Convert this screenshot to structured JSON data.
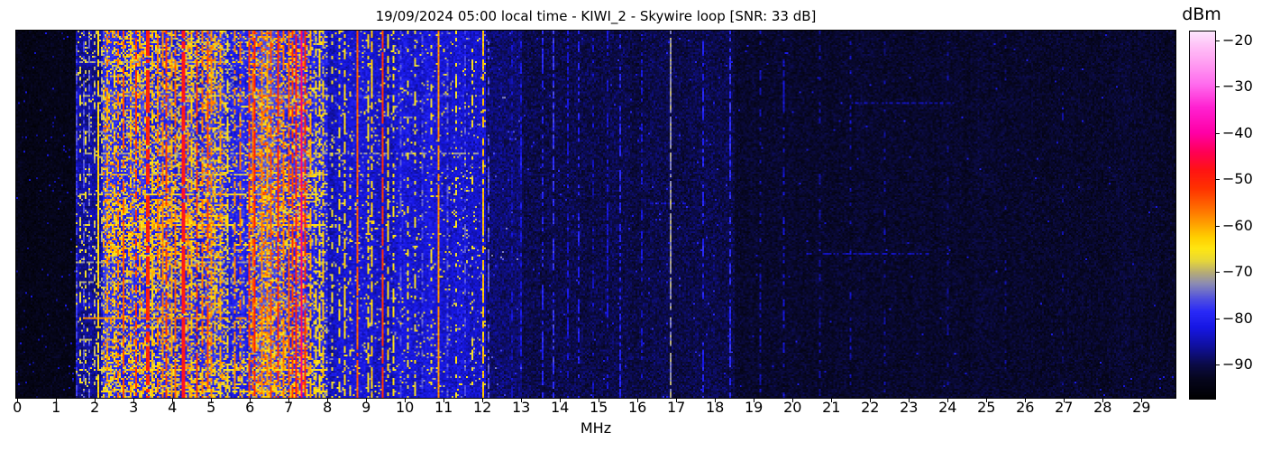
{
  "chart_data": {
    "type": "heatmap",
    "subtype": "spectrogram-waterfall",
    "title": "19/09/2024 05:00 local time - KIWI_2 - Skywire loop [SNR: 33 dB]",
    "xlabel": "MHz",
    "colorbar_label": "dBm",
    "x_range_mhz": [
      -0.05,
      29.9
    ],
    "x_ticks": [
      0,
      1,
      2,
      3,
      4,
      5,
      6,
      7,
      8,
      9,
      10,
      11,
      12,
      13,
      14,
      15,
      16,
      17,
      18,
      19,
      20,
      21,
      22,
      23,
      24,
      25,
      26,
      27,
      28,
      29
    ],
    "value_range_dbm": [
      -97.3,
      -18.1
    ],
    "colorbar_ticks": [
      {
        "value": -20,
        "label": "−20"
      },
      {
        "value": -30,
        "label": "−30"
      },
      {
        "value": -40,
        "label": "−40"
      },
      {
        "value": -50,
        "label": "−50"
      },
      {
        "value": -60,
        "label": "−60"
      },
      {
        "value": -70,
        "label": "−70"
      },
      {
        "value": -80,
        "label": "−80"
      },
      {
        "value": -90,
        "label": "−90"
      }
    ],
    "colormap_stops": [
      {
        "dbm": -97.5,
        "color": "#000000"
      },
      {
        "dbm": -93.0,
        "color": "#06061e"
      },
      {
        "dbm": -90.0,
        "color": "#0b0b46"
      },
      {
        "dbm": -86.0,
        "color": "#10109e"
      },
      {
        "dbm": -82.0,
        "color": "#1717e4"
      },
      {
        "dbm": -78.5,
        "color": "#2a2af8"
      },
      {
        "dbm": -75.5,
        "color": "#5555dd"
      },
      {
        "dbm": -72.5,
        "color": "#8c8cb4"
      },
      {
        "dbm": -70.0,
        "color": "#b8ae74"
      },
      {
        "dbm": -67.5,
        "color": "#e8d838"
      },
      {
        "dbm": -65.0,
        "color": "#ffe713"
      },
      {
        "dbm": -62.5,
        "color": "#ffcf00"
      },
      {
        "dbm": -59.5,
        "color": "#ffa000"
      },
      {
        "dbm": -56.0,
        "color": "#ff6a00"
      },
      {
        "dbm": -52.0,
        "color": "#ff3300"
      },
      {
        "dbm": -48.0,
        "color": "#ff1414"
      },
      {
        "dbm": -44.0,
        "color": "#ff0058"
      },
      {
        "dbm": -40.0,
        "color": "#ff00a6"
      },
      {
        "dbm": -34.5,
        "color": "#ff22d2"
      },
      {
        "dbm": -29.5,
        "color": "#ff6cee"
      },
      {
        "dbm": -25.0,
        "color": "#ff9df2"
      },
      {
        "dbm": -21.0,
        "color": "#ffc4f8"
      },
      {
        "dbm": -18.0,
        "color": "#fde7fe"
      }
    ],
    "noise_regions": [
      {
        "f0": 0.0,
        "f1": 1.5,
        "base": -94,
        "var": 2.5,
        "hot_p": 0.012,
        "hot_min": -88,
        "hot_max": -82
      },
      {
        "f0": 1.5,
        "f1": 2.2,
        "base": -86,
        "var": 3.0,
        "hot_p": 0.06,
        "hot_min": -72,
        "hot_max": -64
      },
      {
        "f0": 2.2,
        "f1": 5.45,
        "base": -80,
        "var": 4.0,
        "hot_p": 0.34,
        "hot_min": -73,
        "hot_max": -58
      },
      {
        "f0": 5.45,
        "f1": 5.95,
        "base": -81,
        "var": 3.5,
        "hot_p": 0.18,
        "hot_min": -73,
        "hot_max": -62
      },
      {
        "f0": 5.95,
        "f1": 7.55,
        "base": -78,
        "var": 4.0,
        "hot_p": 0.4,
        "hot_min": -72,
        "hot_max": -55
      },
      {
        "f0": 7.55,
        "f1": 8.0,
        "base": -80,
        "var": 4.0,
        "hot_p": 0.25,
        "hot_min": -72,
        "hot_max": -62
      },
      {
        "f0": 8.0,
        "f1": 12.1,
        "base": -83,
        "var": 4.0,
        "hot_p": 0.06,
        "hot_min": -75,
        "hot_max": -63
      },
      {
        "f0": 12.1,
        "f1": 13.0,
        "base": -88,
        "var": 3.5,
        "hot_p": 0.01,
        "hot_min": -80,
        "hot_max": -72
      },
      {
        "f0": 13.0,
        "f1": 18.5,
        "base": -90,
        "var": 3.5,
        "hot_p": 0.005,
        "hot_min": -82,
        "hot_max": -78
      },
      {
        "f0": 18.5,
        "f1": 29.95,
        "base": -92,
        "var": 3.0,
        "hot_p": 0.002,
        "hot_min": -84,
        "hot_max": -80
      }
    ],
    "signal_lines": [
      {
        "mhz": 1.53,
        "dbm": -77,
        "density": 0.55,
        "w": 1
      },
      {
        "mhz": 1.62,
        "dbm": -67,
        "density": 0.3,
        "w": 1
      },
      {
        "mhz": 1.7,
        "dbm": -76,
        "density": 0.5,
        "w": 1
      },
      {
        "mhz": 1.76,
        "dbm": -67,
        "density": 0.32,
        "w": 1
      },
      {
        "mhz": 1.85,
        "dbm": -75,
        "density": 0.5,
        "w": 1
      },
      {
        "mhz": 1.95,
        "dbm": -70,
        "density": 0.3,
        "w": 1
      },
      {
        "mhz": 2.05,
        "dbm": -63,
        "density": 0.9,
        "w": 1
      },
      {
        "mhz": 2.17,
        "dbm": -70,
        "density": 0.4,
        "w": 1
      },
      {
        "mhz": 2.3,
        "dbm": -60,
        "density": 0.5,
        "w": 1
      },
      {
        "mhz": 2.47,
        "dbm": -64,
        "density": 0.55,
        "w": 1
      },
      {
        "mhz": 2.6,
        "dbm": -57,
        "density": 0.6,
        "w": 1
      },
      {
        "mhz": 2.72,
        "dbm": -54,
        "density": 0.75,
        "w": 1
      },
      {
        "mhz": 2.88,
        "dbm": -62,
        "density": 0.6,
        "w": 1
      },
      {
        "mhz": 3.02,
        "dbm": -52,
        "density": 0.65,
        "w": 1
      },
      {
        "mhz": 3.15,
        "dbm": -60,
        "density": 0.6,
        "w": 1
      },
      {
        "mhz": 3.33,
        "dbm": -50,
        "density": 0.85,
        "w": 2
      },
      {
        "mhz": 3.48,
        "dbm": -62,
        "density": 0.7,
        "w": 1
      },
      {
        "mhz": 3.6,
        "dbm": -56,
        "density": 0.6,
        "w": 1
      },
      {
        "mhz": 3.72,
        "dbm": -57,
        "density": 0.65,
        "w": 1
      },
      {
        "mhz": 3.85,
        "dbm": -52,
        "density": 0.75,
        "w": 1
      },
      {
        "mhz": 3.95,
        "dbm": -60,
        "density": 0.7,
        "w": 1
      },
      {
        "mhz": 4.05,
        "dbm": -55,
        "density": 0.7,
        "w": 1
      },
      {
        "mhz": 4.27,
        "dbm": -48,
        "density": 0.93,
        "w": 2
      },
      {
        "mhz": 4.4,
        "dbm": -58,
        "density": 0.6,
        "w": 1
      },
      {
        "mhz": 4.5,
        "dbm": -62,
        "density": 0.6,
        "w": 1
      },
      {
        "mhz": 4.62,
        "dbm": -52,
        "density": 0.8,
        "w": 1
      },
      {
        "mhz": 4.75,
        "dbm": -56,
        "density": 0.6,
        "w": 1
      },
      {
        "mhz": 4.9,
        "dbm": -53,
        "density": 0.7,
        "w": 1
      },
      {
        "mhz": 5.0,
        "dbm": -58,
        "density": 0.6,
        "w": 1
      },
      {
        "mhz": 5.1,
        "dbm": -63,
        "density": 0.5,
        "w": 1
      },
      {
        "mhz": 5.25,
        "dbm": -60,
        "density": 0.5,
        "w": 1
      },
      {
        "mhz": 5.4,
        "dbm": -65,
        "density": 0.5,
        "w": 1
      },
      {
        "mhz": 5.6,
        "dbm": -58,
        "density": 0.55,
        "w": 1
      },
      {
        "mhz": 5.75,
        "dbm": -56,
        "density": 0.6,
        "w": 1
      },
      {
        "mhz": 5.95,
        "dbm": -52,
        "density": 0.72,
        "w": 1
      },
      {
        "mhz": 6.05,
        "dbm": -56,
        "density": 0.75,
        "w": 1
      },
      {
        "mhz": 6.12,
        "dbm": -50,
        "density": 0.8,
        "w": 1
      },
      {
        "mhz": 6.3,
        "dbm": -58,
        "density": 0.7,
        "w": 1
      },
      {
        "mhz": 6.45,
        "dbm": -60,
        "density": 0.7,
        "w": 1
      },
      {
        "mhz": 6.55,
        "dbm": -54,
        "density": 0.7,
        "w": 1
      },
      {
        "mhz": 6.7,
        "dbm": -50,
        "density": 0.78,
        "w": 1
      },
      {
        "mhz": 6.85,
        "dbm": -57,
        "density": 0.7,
        "w": 1
      },
      {
        "mhz": 6.98,
        "dbm": -54,
        "density": 0.8,
        "w": 1
      },
      {
        "mhz": 7.08,
        "dbm": -52,
        "density": 0.7,
        "w": 1
      },
      {
        "mhz": 7.18,
        "dbm": -48,
        "density": 0.85,
        "w": 1
      },
      {
        "mhz": 7.32,
        "dbm": -43,
        "density": 0.97,
        "w": 1
      },
      {
        "mhz": 7.42,
        "dbm": -50,
        "density": 0.8,
        "w": 1
      },
      {
        "mhz": 7.55,
        "dbm": -60,
        "density": 0.7,
        "w": 1
      },
      {
        "mhz": 7.68,
        "dbm": -64,
        "density": 0.5,
        "w": 1
      },
      {
        "mhz": 7.8,
        "dbm": -63,
        "density": 0.5,
        "w": 1
      },
      {
        "mhz": 7.9,
        "dbm": -62,
        "density": 0.55,
        "w": 1
      },
      {
        "mhz": 8.1,
        "dbm": -66,
        "density": 0.35,
        "w": 1
      },
      {
        "mhz": 8.3,
        "dbm": -65,
        "density": 0.4,
        "w": 1
      },
      {
        "mhz": 8.45,
        "dbm": -64,
        "density": 0.5,
        "w": 1
      },
      {
        "mhz": 8.6,
        "dbm": -67,
        "density": 0.3,
        "w": 1
      },
      {
        "mhz": 8.75,
        "dbm": -55,
        "density": 0.88,
        "w": 1
      },
      {
        "mhz": 9.05,
        "dbm": -64,
        "density": 0.6,
        "w": 1
      },
      {
        "mhz": 9.15,
        "dbm": -63,
        "density": 0.7,
        "w": 1
      },
      {
        "mhz": 9.4,
        "dbm": -52,
        "density": 0.88,
        "w": 1
      },
      {
        "mhz": 9.55,
        "dbm": -64,
        "density": 0.5,
        "w": 1
      },
      {
        "mhz": 9.7,
        "dbm": -65,
        "density": 0.45,
        "w": 1
      },
      {
        "mhz": 9.9,
        "dbm": -76,
        "density": 0.5,
        "w": 1
      },
      {
        "mhz": 10.05,
        "dbm": -66,
        "density": 0.3,
        "w": 1
      },
      {
        "mhz": 10.25,
        "dbm": -66,
        "density": 0.35,
        "w": 1
      },
      {
        "mhz": 10.45,
        "dbm": -76,
        "density": 0.5,
        "w": 1
      },
      {
        "mhz": 10.65,
        "dbm": -66,
        "density": 0.3,
        "w": 1
      },
      {
        "mhz": 10.85,
        "dbm": -58,
        "density": 0.95,
        "w": 1
      },
      {
        "mhz": 11.1,
        "dbm": -76,
        "density": 0.5,
        "w": 1
      },
      {
        "mhz": 11.3,
        "dbm": -66,
        "density": 0.3,
        "w": 1
      },
      {
        "mhz": 11.55,
        "dbm": -76,
        "density": 0.45,
        "w": 1
      },
      {
        "mhz": 11.75,
        "dbm": -66,
        "density": 0.25,
        "w": 1
      },
      {
        "mhz": 12.0,
        "dbm": -62,
        "density": 0.8,
        "w": 1
      },
      {
        "mhz": 12.15,
        "dbm": -76,
        "density": 0.5,
        "w": 1
      },
      {
        "mhz": 12.75,
        "dbm": -84,
        "density": 0.5,
        "w": 1
      },
      {
        "mhz": 13.0,
        "dbm": -82,
        "density": 0.5,
        "w": 1
      },
      {
        "mhz": 13.55,
        "dbm": -80,
        "density": 0.55,
        "w": 1
      },
      {
        "mhz": 13.85,
        "dbm": -78,
        "density": 0.6,
        "w": 1
      },
      {
        "mhz": 14.2,
        "dbm": -83,
        "density": 0.5,
        "w": 1
      },
      {
        "mhz": 14.5,
        "dbm": -80,
        "density": 0.5,
        "w": 1
      },
      {
        "mhz": 14.85,
        "dbm": -84,
        "density": 0.4,
        "w": 1
      },
      {
        "mhz": 15.25,
        "dbm": -83,
        "density": 0.4,
        "w": 1
      },
      {
        "mhz": 15.55,
        "dbm": -80,
        "density": 0.5,
        "w": 1
      },
      {
        "mhz": 16.1,
        "dbm": -83,
        "density": 0.4,
        "w": 1
      },
      {
        "mhz": 16.85,
        "dbm": -72,
        "density": 0.85,
        "w": 1
      },
      {
        "mhz": 17.7,
        "dbm": -80,
        "density": 0.5,
        "w": 1
      },
      {
        "mhz": 18.4,
        "dbm": -79,
        "density": 0.55,
        "w": 1
      },
      {
        "mhz": 19.2,
        "dbm": -85,
        "density": 0.35,
        "w": 1
      },
      {
        "mhz": 19.8,
        "dbm": -83,
        "density": 0.35,
        "w": 1
      },
      {
        "mhz": 20.7,
        "dbm": -86,
        "density": 0.3,
        "w": 1
      },
      {
        "mhz": 21.5,
        "dbm": -85,
        "density": 0.3,
        "w": 1
      },
      {
        "mhz": 22.4,
        "dbm": -86,
        "density": 0.25,
        "w": 1
      },
      {
        "mhz": 24.0,
        "dbm": -87,
        "density": 0.2,
        "w": 1
      },
      {
        "mhz": 25.5,
        "dbm": -87,
        "density": 0.2,
        "w": 1
      },
      {
        "mhz": 27.0,
        "dbm": -87,
        "density": 0.2,
        "w": 1
      }
    ],
    "bursts": [
      {
        "y": 0.085,
        "f0": 1.6,
        "f1": 5.4,
        "dbm": -71,
        "density": 0.6
      },
      {
        "y": 0.175,
        "f0": 1.6,
        "f1": 8.1,
        "dbm": -69,
        "density": 0.65
      },
      {
        "y": 0.175,
        "f0": 8.1,
        "f1": 12.0,
        "dbm": -77,
        "density": 0.5
      },
      {
        "y": 0.195,
        "f0": 21.5,
        "f1": 24.2,
        "dbm": -85,
        "density": 0.55
      },
      {
        "y": 0.235,
        "f0": 9.95,
        "f1": 10.18,
        "dbm": -73,
        "density": 0.9
      },
      {
        "y": 0.275,
        "f0": 1.6,
        "f1": 5.5,
        "dbm": -73,
        "density": 0.55
      },
      {
        "y": 0.335,
        "f0": 1.6,
        "f1": 12.0,
        "dbm": -72,
        "density": 0.5
      },
      {
        "y": 0.39,
        "f0": 1.6,
        "f1": 8.0,
        "dbm": -70,
        "density": 0.6
      },
      {
        "y": 0.445,
        "f0": 1.6,
        "f1": 8.05,
        "dbm": -68,
        "density": 0.6
      },
      {
        "y": 0.47,
        "f0": 16.3,
        "f1": 17.3,
        "dbm": -84,
        "density": 0.55
      },
      {
        "y": 0.53,
        "f0": 1.6,
        "f1": 8.0,
        "dbm": -66,
        "density": 0.6
      },
      {
        "y": 0.61,
        "f0": 20.3,
        "f1": 23.6,
        "dbm": -85,
        "density": 0.55
      },
      {
        "y": 0.63,
        "f0": 1.5,
        "f1": 8.0,
        "dbm": -72,
        "density": 0.6
      },
      {
        "y": 0.685,
        "f0": 1.6,
        "f1": 6.2,
        "dbm": -71,
        "density": 0.55
      },
      {
        "y": 0.785,
        "f0": 1.6,
        "f1": 6.6,
        "dbm": -59,
        "density": 0.78
      },
      {
        "y": 0.807,
        "f0": 2.0,
        "f1": 8.0,
        "dbm": -68,
        "density": 0.6
      },
      {
        "y": 0.845,
        "f0": 1.6,
        "f1": 5.2,
        "dbm": -70,
        "density": 0.55
      },
      {
        "y": 0.925,
        "f0": 1.6,
        "f1": 8.0,
        "dbm": -66,
        "density": 0.65
      },
      {
        "y": 0.985,
        "f0": 2.0,
        "f1": 8.0,
        "dbm": -64,
        "density": 0.7
      }
    ],
    "patches": [
      {
        "y0": 0.46,
        "y1": 0.61,
        "f0": 2.3,
        "f1": 5.45,
        "p": 0.33,
        "min": -70,
        "max": -58
      },
      {
        "y0": 0.03,
        "y1": 0.17,
        "f0": 2.5,
        "f1": 5.3,
        "p": 0.22,
        "min": -71,
        "max": -60
      },
      {
        "y0": 0.6,
        "y1": 0.76,
        "f0": 3.1,
        "f1": 5.3,
        "p": 0.16,
        "min": -72,
        "max": -62
      },
      {
        "y0": 0.9,
        "y1": 1.0,
        "f0": 2.2,
        "f1": 7.9,
        "p": 0.22,
        "min": -70,
        "max": -60
      },
      {
        "y0": 0.28,
        "y1": 0.43,
        "f0": 3.2,
        "f1": 5.4,
        "p": 0.15,
        "min": -72,
        "max": -62
      },
      {
        "y0": 0.74,
        "y1": 0.89,
        "f0": 5.9,
        "f1": 7.55,
        "p": 0.2,
        "min": -70,
        "max": -58
      },
      {
        "y0": 0.42,
        "y1": 0.62,
        "f0": 5.9,
        "f1": 7.55,
        "p": 0.15,
        "min": -71,
        "max": -60
      }
    ]
  }
}
